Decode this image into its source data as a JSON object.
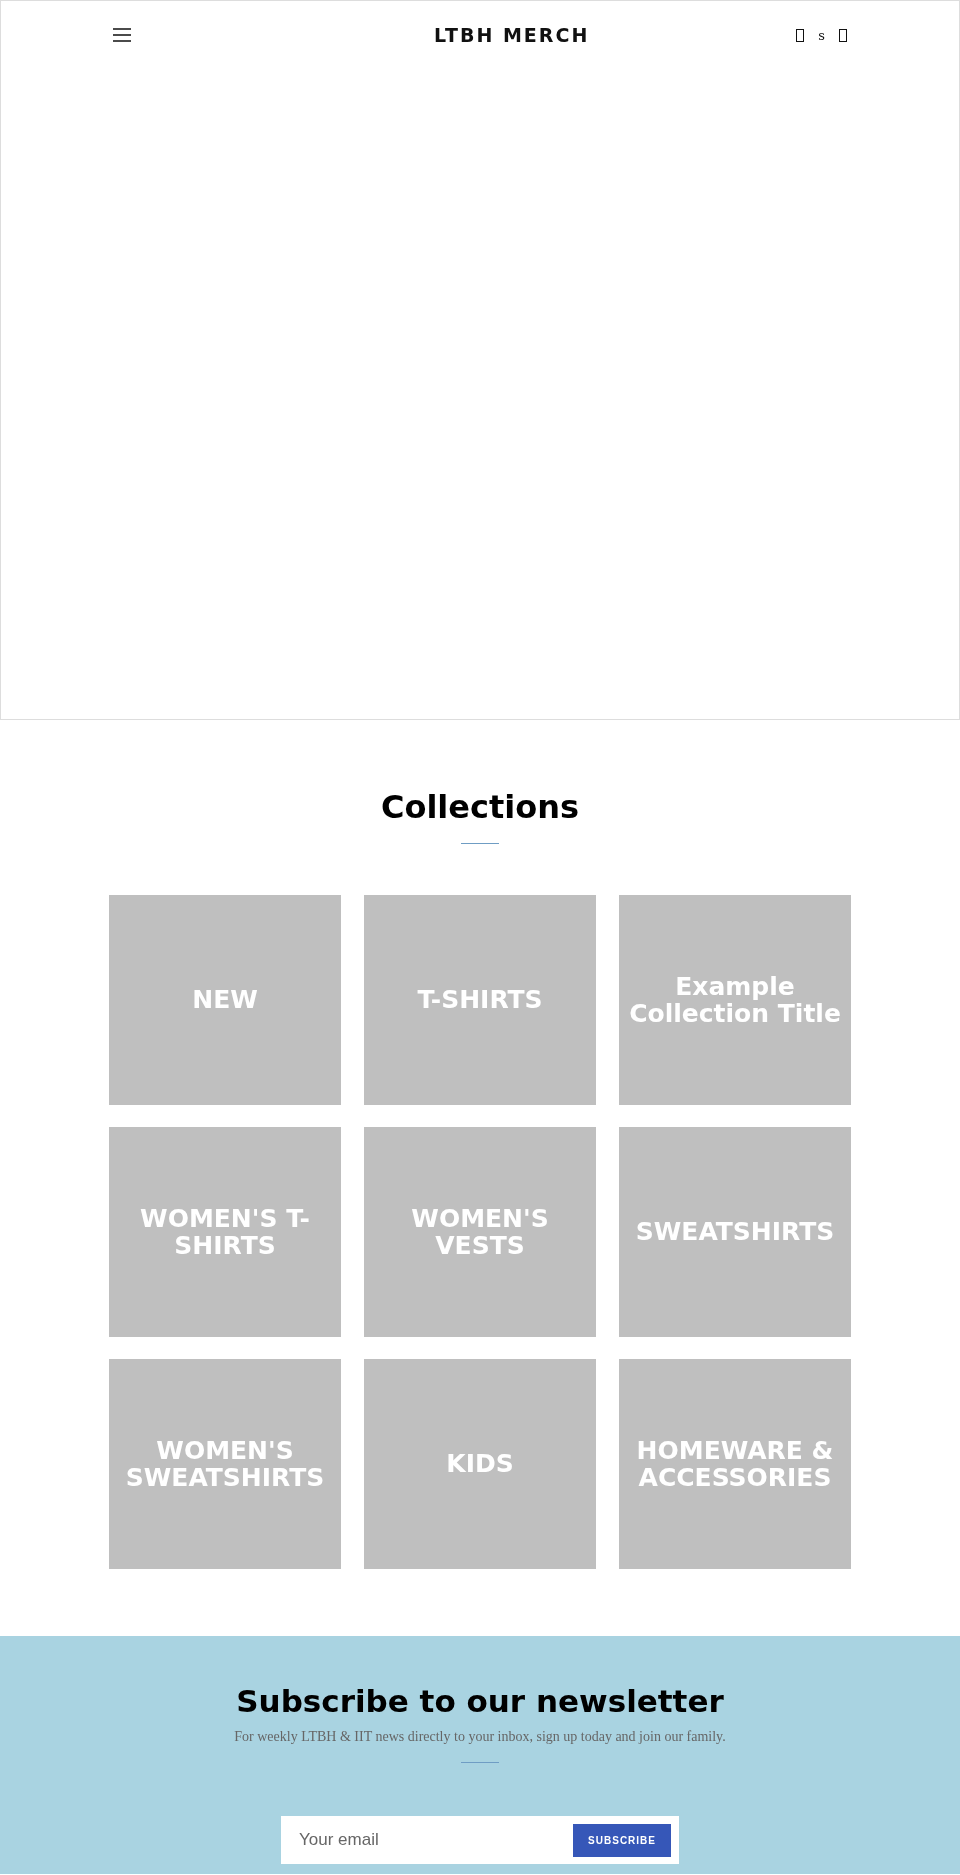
{
  "header": {
    "logo": "LTBH MERCH",
    "icon_text": "s"
  },
  "collections": {
    "title": "Collections",
    "items": [
      {
        "title": "NEW"
      },
      {
        "title": "T-SHIRTS"
      },
      {
        "title": "Example Collection Title"
      },
      {
        "title": "WOMEN'S T-SHIRTS"
      },
      {
        "title": "WOMEN'S VESTS"
      },
      {
        "title": "SWEATSHIRTS"
      },
      {
        "title": "WOMEN'S SWEATSHIRTS"
      },
      {
        "title": "KIDS"
      },
      {
        "title": "HOMEWARE & ACCESSORIES"
      }
    ]
  },
  "newsletter": {
    "title": "Subscribe to our newsletter",
    "subtitle": "For weekly LTBH & IIT news directly to your inbox, sign up today and join our family.",
    "placeholder": "Your email",
    "button": "SUBSCRIBE"
  }
}
